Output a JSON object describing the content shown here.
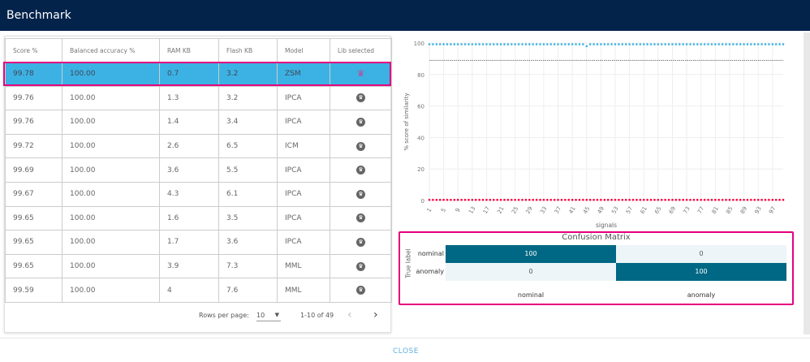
{
  "header": {
    "title": "Benchmark"
  },
  "table": {
    "columns": [
      "Score %",
      "Balanced accuracy %",
      "RAM KB",
      "Flash KB",
      "Model",
      "Lib selected"
    ],
    "rows": [
      {
        "score": "99.78",
        "bacc": "100.00",
        "ram": "0.7",
        "flash": "3.2",
        "model": "ZSM",
        "selected": true
      },
      {
        "score": "99.76",
        "bacc": "100.00",
        "ram": "1.3",
        "flash": "3.2",
        "model": "IPCA",
        "selected": false
      },
      {
        "score": "99.76",
        "bacc": "100.00",
        "ram": "1.4",
        "flash": "3.4",
        "model": "IPCA",
        "selected": false
      },
      {
        "score": "99.72",
        "bacc": "100.00",
        "ram": "2.6",
        "flash": "6.5",
        "model": "ICM",
        "selected": false
      },
      {
        "score": "99.69",
        "bacc": "100.00",
        "ram": "3.6",
        "flash": "5.5",
        "model": "IPCA",
        "selected": false
      },
      {
        "score": "99.67",
        "bacc": "100.00",
        "ram": "4.3",
        "flash": "6.1",
        "model": "IPCA",
        "selected": false
      },
      {
        "score": "99.65",
        "bacc": "100.00",
        "ram": "1.6",
        "flash": "3.5",
        "model": "IPCA",
        "selected": false
      },
      {
        "score": "99.65",
        "bacc": "100.00",
        "ram": "1.7",
        "flash": "3.6",
        "model": "IPCA",
        "selected": false
      },
      {
        "score": "99.65",
        "bacc": "100.00",
        "ram": "3.9",
        "flash": "7.3",
        "model": "MML",
        "selected": false
      },
      {
        "score": "99.59",
        "bacc": "100.00",
        "ram": "4",
        "flash": "7.6",
        "model": "MML",
        "selected": false
      }
    ],
    "icons": {
      "selected": "crown-icon-highlighted",
      "unselected": "crown-icon"
    }
  },
  "pagination": {
    "rows_per_page_label": "Rows per page:",
    "rows_per_page": "10",
    "range": "1-10 of 49",
    "prev": "‹",
    "next": "›"
  },
  "chart_data": {
    "type": "scatter",
    "xlabel": "signals",
    "ylabel": "% score of similarity",
    "ylim": [
      0,
      100
    ],
    "yticks": [
      0,
      20,
      40,
      60,
      80,
      100
    ],
    "xlim": [
      1,
      100
    ],
    "xticks": [
      1,
      5,
      9,
      13,
      17,
      21,
      25,
      29,
      33,
      37,
      41,
      45,
      49,
      53,
      57,
      61,
      65,
      69,
      73,
      77,
      81,
      85,
      89,
      93,
      97
    ],
    "grid": true,
    "threshold": 89,
    "colors": {
      "nominal": "#3bb2e3",
      "anomaly": "#ff0040",
      "threshold": "#777777"
    },
    "series": [
      {
        "values": [
          99.2,
          99.2,
          99.2,
          99.2,
          99.2,
          99.2,
          99.2,
          99.2,
          99.2,
          99.2,
          99.2,
          99.2,
          99.2,
          99.2,
          99.2,
          99.2,
          99.2,
          99.2,
          99.2,
          99.2,
          99.2,
          99.2,
          99.2,
          99.2,
          99.2,
          99.2,
          99.2,
          99.2,
          99.2,
          99.2,
          99.2,
          99.2,
          99.2,
          99.2,
          99.2,
          99.2,
          99.2,
          99.2,
          99.2,
          99.2,
          99.2,
          99.2,
          99.2,
          99.2,
          98.0,
          99.2,
          99.2,
          99.2,
          99.2,
          99.2,
          99.2,
          99.2,
          99.2,
          99.2,
          99.2,
          99.2,
          99.2,
          99.2,
          99.2,
          99.2,
          99.2,
          99.2,
          99.2,
          99.2,
          99.2,
          99.2,
          99.2,
          99.2,
          99.2,
          99.2,
          99.2,
          99.2,
          99.2,
          99.2,
          99.2,
          99.2,
          99.2,
          99.2,
          99.2,
          99.2,
          99.2,
          99.2,
          99.2,
          99.2,
          99.2,
          99.2,
          99.2,
          99.2,
          99.2,
          99.2,
          99.2,
          99.2,
          99.2,
          99.2,
          99.2,
          99.2,
          99.2,
          99.2,
          99.2,
          99.2
        ]
      },
      {
        "values": [
          0.4,
          0.4,
          0.4,
          0.4,
          0.4,
          0.4,
          0.4,
          0.4,
          0.4,
          0.4,
          0.4,
          0.4,
          0.4,
          0.4,
          0.4,
          0.4,
          0.4,
          0.4,
          0.4,
          0.4,
          0.4,
          0.4,
          0.4,
          0.4,
          0.4,
          0.4,
          0.4,
          0.4,
          0.4,
          0.4,
          0.4,
          0.4,
          0.4,
          0.4,
          0.4,
          0.4,
          0.4,
          0.4,
          0.4,
          0.4,
          0.4,
          0.4,
          0.4,
          0.4,
          0.4,
          0.4,
          0.4,
          0.4,
          0.4,
          0.4,
          0.4,
          0.4,
          0.4,
          0.4,
          0.4,
          0.4,
          0.4,
          0.4,
          0.4,
          0.4,
          0.4,
          0.4,
          0.4,
          0.4,
          0.4,
          0.4,
          0.4,
          0.4,
          0.4,
          0.4,
          0.4,
          0.4,
          0.4,
          0.4,
          0.4,
          0.4,
          0.4,
          0.4,
          0.4,
          0.4,
          0.4,
          0.4,
          0.4,
          0.4,
          0.4,
          0.4,
          0.4,
          0.4,
          0.4,
          0.4,
          0.4,
          0.4,
          0.4,
          0.4,
          0.4,
          0.4,
          0.4,
          0.4,
          0.4,
          0.4
        ]
      }
    ]
  },
  "confusion_matrix": {
    "title": "Confusion Matrix",
    "ylabel": "True label",
    "labels": [
      "nominal",
      "anomaly"
    ],
    "values": [
      [
        "100",
        "0"
      ],
      [
        "0",
        "100"
      ]
    ],
    "colors": {
      "high": "#006884",
      "low": "#eef5f8"
    }
  },
  "footer": {
    "close": "CLOSE"
  }
}
